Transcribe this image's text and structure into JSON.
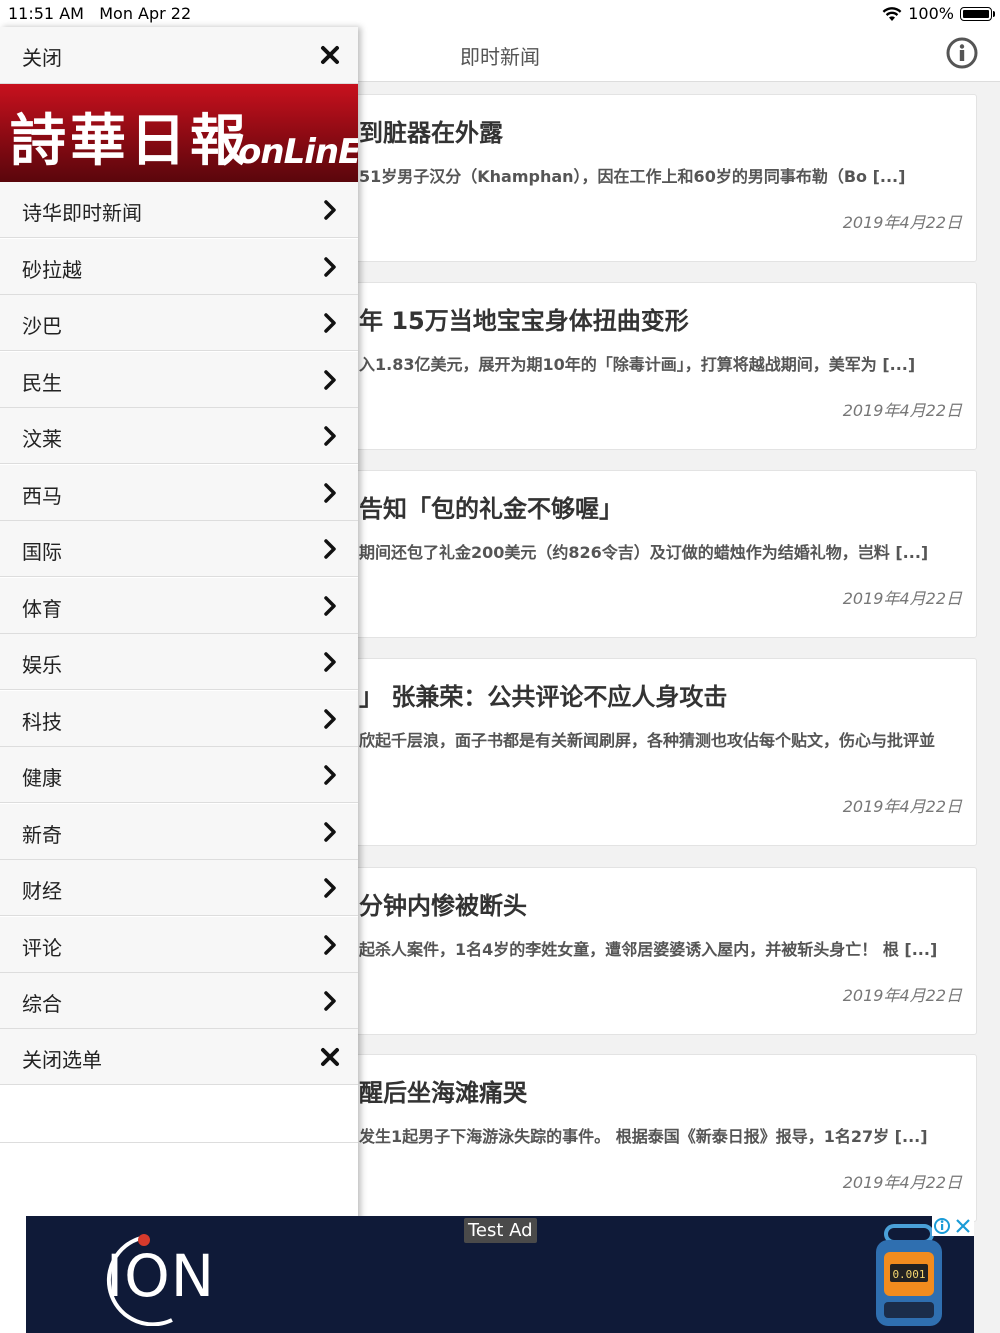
{
  "status": {
    "time": "11:51 AM",
    "date": "Mon Apr 22",
    "battery": "100%"
  },
  "nav": {
    "title": "即时新闻"
  },
  "articles": [
    {
      "title": "到脏器在外露",
      "excerpt": "51岁男子汉分（Khamphan），因在工作上和60岁的男同事布勒（Bo [...]",
      "date": "2019年4月22日"
    },
    {
      "title": "年 15万当地宝宝身体扭曲变形",
      "excerpt": "入1.83亿美元，展开为期10年的「除毒计画」，打算将越战期间，美军为 [...]",
      "date": "2019年4月22日"
    },
    {
      "title": "告知「包的礼金不够喔」",
      "excerpt": "期间还包了礼金200美元（约826令吉）及订做的蜡烛作为结婚礼物，岂料 [...]",
      "date": "2019年4月22日"
    },
    {
      "title": "」 张兼荣：公共评论不应人身攻击",
      "excerpt": "欣起千层浪，面子书都是有关新闻刷屏，各种猜测也攻佔每个贴文，伤心与批评並",
      "date": "2019年4月22日"
    },
    {
      "title": "分钟内惨被断头",
      "excerpt": "起杀人案件，1名4岁的李姓女童，遭邻居婆婆诱入屋内，并被斩头身亡！ 根 [...]",
      "date": "2019年4月22日"
    },
    {
      "title": "醒后坐海滩痛哭",
      "excerpt": "发生1起男子下海游泳失踪的事件。 根据泰国《新泰日报》报导，1名27岁 [...]",
      "date": "2019年4月22日"
    }
  ],
  "drawer": {
    "close_label": "关闭",
    "logo": {
      "cn": "詩華日報",
      "en": "onLinE"
    },
    "items": [
      "诗华即时新闻",
      "砂拉越",
      "沙巴",
      "民生",
      "汶莱",
      "西马",
      "国际",
      "体育",
      "娱乐",
      "科技",
      "健康",
      "新奇",
      "财经",
      "评论",
      "综合"
    ],
    "close_menu_label": "关闭选单"
  },
  "ad": {
    "label": "Test Ad",
    "brand": "ION",
    "device_readout": "0.001"
  },
  "icons": {
    "close": "close-x-icon",
    "chevron": "chevron-right-icon",
    "info": "info-icon",
    "wifi": "wifi-icon",
    "battery": "battery-icon",
    "ad_choices": "ad-choices-icon"
  },
  "colors": {
    "logo_red": "#c8111e",
    "ad_bg": "#0f1a38",
    "divider": "#dddddd"
  }
}
